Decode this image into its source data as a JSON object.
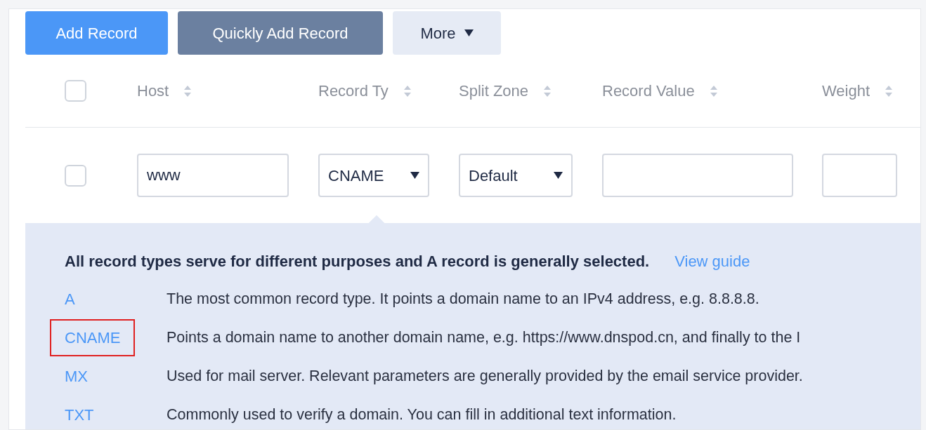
{
  "toolbar": {
    "buttons": [
      {
        "label": "Add Record",
        "kind": "primary"
      },
      {
        "label": "Quickly Add Record",
        "kind": "secondary"
      },
      {
        "label": "More",
        "kind": "dropdown"
      }
    ]
  },
  "table": {
    "header_checkbox": {
      "checked": false
    },
    "columns": [
      {
        "label": "Host"
      },
      {
        "label": "Record Ty"
      },
      {
        "label": "Split Zone"
      },
      {
        "label": "Record Value"
      },
      {
        "label": "Weight"
      }
    ],
    "row": {
      "checked": false,
      "host": "www",
      "record_type": "CNAME",
      "split_zone": "Default"
    }
  },
  "help": {
    "title": "All record types serve for different purposes and A record is generally selected.",
    "link": "View guide",
    "types": [
      {
        "name": "A",
        "description": "The most common record type. It points a domain name to an IPv4 address, e.g. 8.8.8.8.",
        "highlighted": false
      },
      {
        "name": "CNAME",
        "description": "Points a domain name to another domain name, e.g. https://www.dnspod.cn, and finally to the I",
        "highlighted": true
      },
      {
        "name": "MX",
        "description": "Used for mail server. Relevant parameters are generally provided by the email service provider.",
        "highlighted": false
      },
      {
        "name": "TXT",
        "description": "Commonly used to verify a domain. You can fill in additional text information.",
        "highlighted": false
      }
    ]
  }
}
